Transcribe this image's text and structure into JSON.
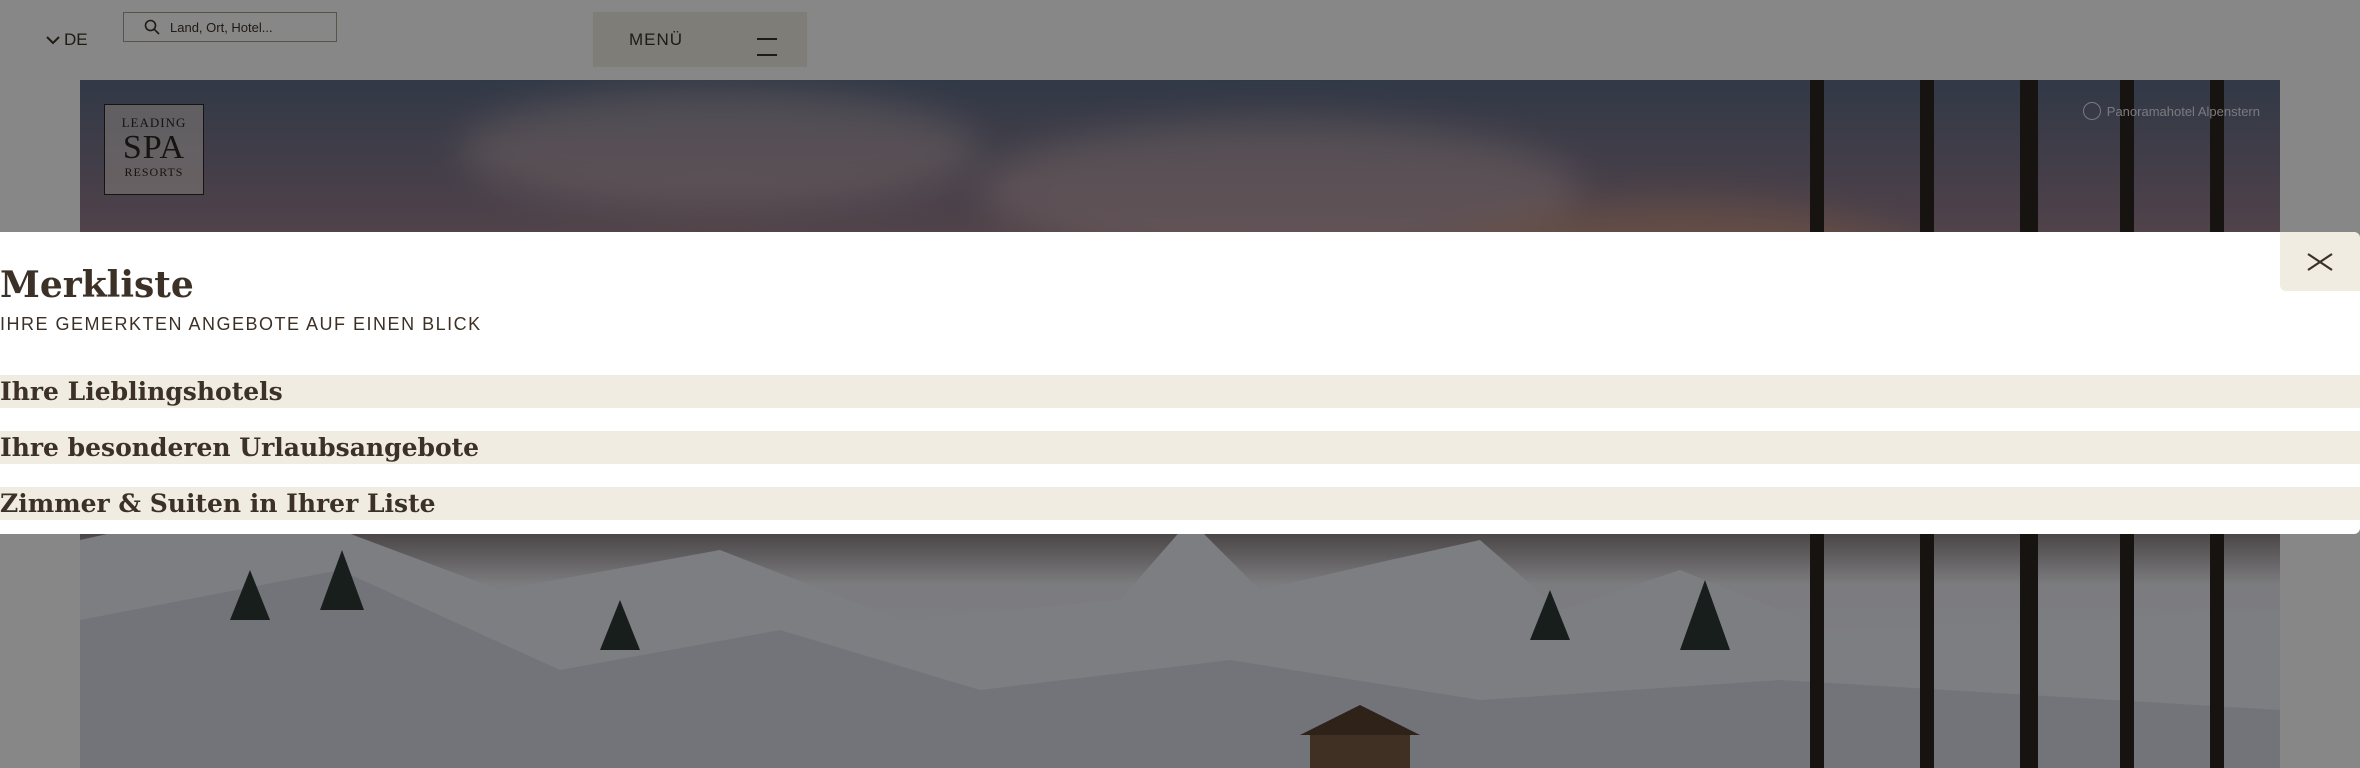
{
  "header": {
    "language": "DE",
    "search_placeholder": "Land, Ort, Hotel...",
    "menu_label": "MENÜ"
  },
  "hero": {
    "logo": {
      "line1": "LEADING",
      "line2": "SPA",
      "line3": "RESORTS"
    },
    "photo_credit": "Panoramahotel Alpenstern"
  },
  "modal": {
    "title": "Merkliste",
    "subtitle": "IHRE GEMERKTEN ANGEBOTE AUF EINEN BLICK",
    "sections": [
      {
        "label": "Ihre Lieblingshotels"
      },
      {
        "label": "Ihre besonderen Urlaubsangebote"
      },
      {
        "label": "Zimmer & Suiten in Ihrer Liste"
      }
    ]
  },
  "colors": {
    "accent_beige": "#f0ece2",
    "text_brown": "#3c3127",
    "overlay": "rgba(0,0,0,0.47)"
  },
  "icons": [
    "chevron-down-icon",
    "search-icon",
    "hamburger-icon",
    "close-icon"
  ]
}
